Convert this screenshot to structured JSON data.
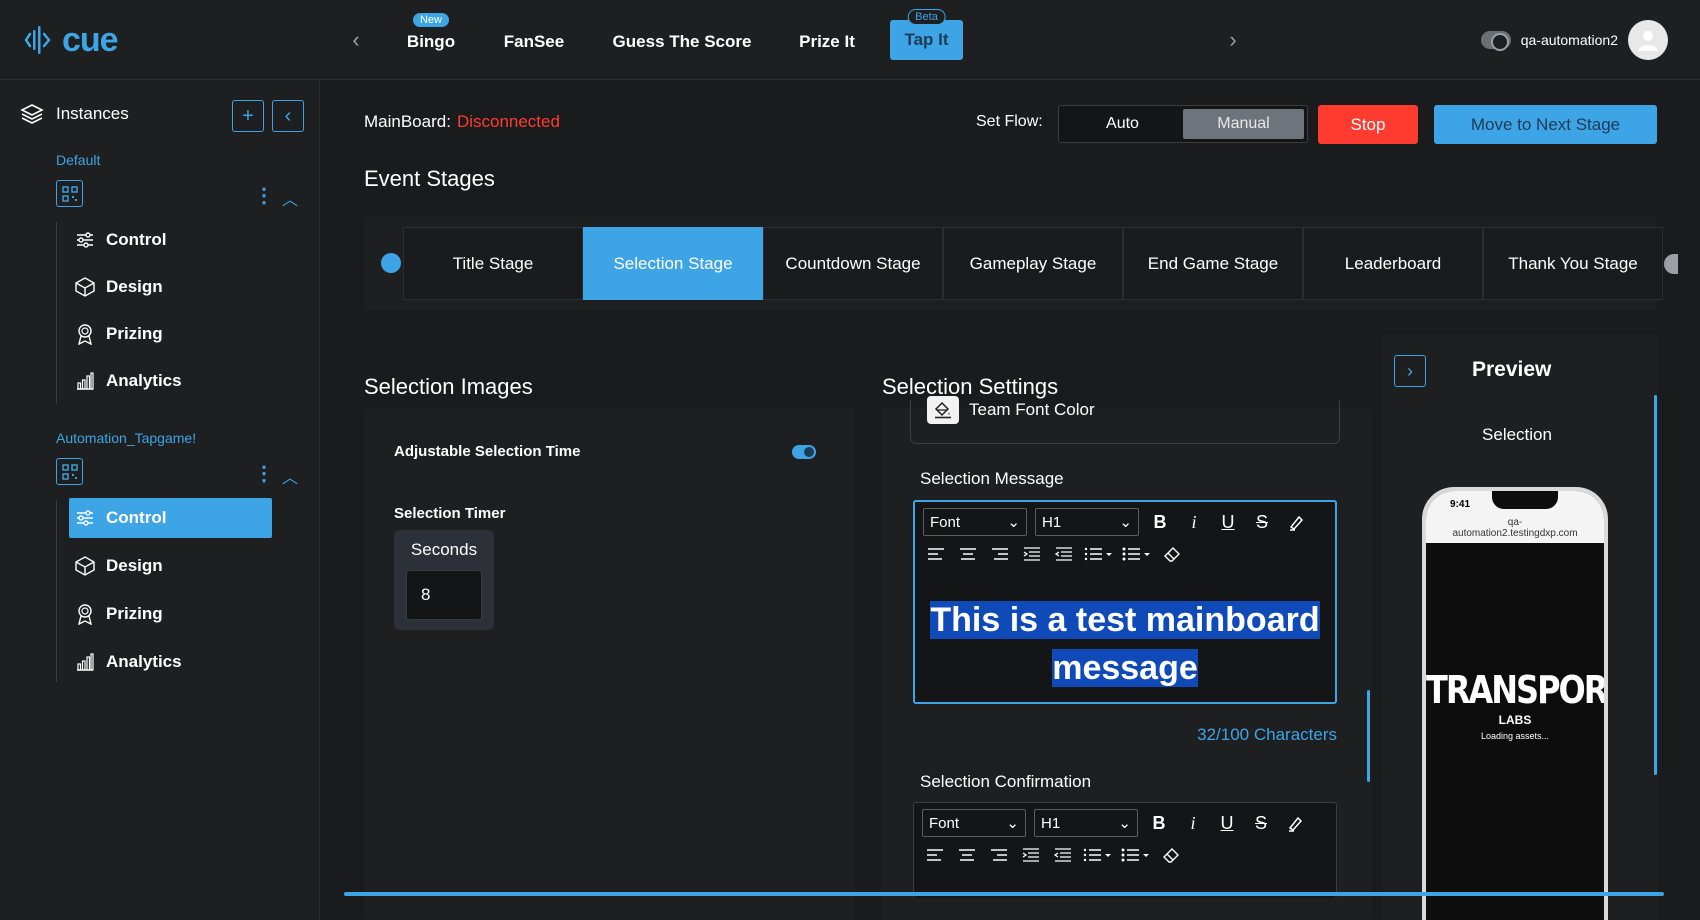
{
  "app": {
    "logo_text": "cue"
  },
  "top_nav": {
    "tabs": [
      {
        "label": "Bingo",
        "badge": "New"
      },
      {
        "label": "FanSee"
      },
      {
        "label": "Guess The Score"
      },
      {
        "label": "Prize It"
      },
      {
        "label": "Tap It",
        "badge": "Beta",
        "active": true
      }
    ],
    "username": "qa-automation2"
  },
  "sidebar": {
    "title": "Instances",
    "instances": [
      {
        "name": "Default",
        "items": [
          "Control",
          "Design",
          "Prizing",
          "Analytics"
        ]
      },
      {
        "name": "Automation_Tapgame!",
        "items": [
          "Control",
          "Design",
          "Prizing",
          "Analytics"
        ],
        "active_item": "Control"
      }
    ]
  },
  "header": {
    "mainboard_label": "MainBoard:",
    "mainboard_status": "Disconnected",
    "set_flow_label": "Set Flow:",
    "flow_options": [
      "Auto",
      "Manual"
    ],
    "flow_selected": "Manual",
    "stop_label": "Stop",
    "next_label": "Move to Next Stage"
  },
  "stages": {
    "heading": "Event Stages",
    "items": [
      "Title Stage",
      "Selection Stage",
      "Countdown Stage",
      "Gameplay Stage",
      "End Game Stage",
      "Leaderboard",
      "Thank You Stage"
    ],
    "active": "Selection Stage"
  },
  "selection_images": {
    "heading": "Selection Images",
    "adjustable_label": "Adjustable Selection Time",
    "adjustable_on": true,
    "timer_label": "Selection Timer",
    "seconds_label": "Seconds",
    "seconds_value": "8"
  },
  "selection_settings": {
    "heading": "Selection Settings",
    "team_font_color_label": "Team Font Color",
    "message_label": "Selection Message",
    "font_select": "Font",
    "heading_select": "H1",
    "message_line1": "This is a test mainboard",
    "message_line2": "message",
    "char_count": "32/100 Characters",
    "confirmation_label": "Selection Confirmation",
    "font_select2": "Font",
    "heading_select2": "H1"
  },
  "preview": {
    "title": "Preview",
    "subtitle": "Selection",
    "phone_time": "9:41",
    "phone_url_line1": "qa-",
    "phone_url_line2": "automation2.testingdxp.com",
    "logo_text": "TRANSPORTED",
    "logo_sub": "LABS",
    "loading_text": "Loading assets..."
  },
  "colors": {
    "accent": "#3da5e6",
    "danger": "#ff3b30",
    "background": "#1a1b1d",
    "panel": "#1e1f21"
  }
}
